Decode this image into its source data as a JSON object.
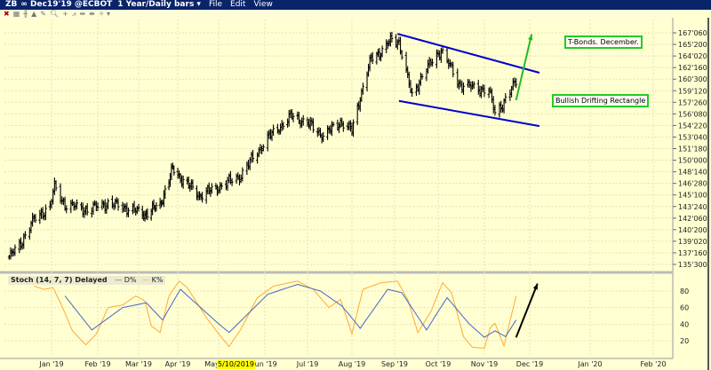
{
  "window": {
    "symbol": "ZB",
    "contract": "∞ Dec19'19 @ECBOT",
    "timeframe": "1 Year/Daily bars",
    "menus": [
      "File",
      "Edit",
      "View"
    ]
  },
  "annotations": {
    "title_note": "T-Bonds. December.",
    "pattern_note": "Bullish Drifting Rectangle"
  },
  "crosshair_date": "5/10/2019",
  "colors": {
    "bars": "#000000",
    "channel": "#0000cc",
    "green_arrow": "#22bb22",
    "k_line": "#ffaa33",
    "d_line": "#4466cc",
    "background": "#ffffd2"
  },
  "chart_data": [
    {
      "type": "ohlc",
      "title": "ZB Dec19'19 @ECBOT 1 Year/Daily bars",
      "y_ticks": [
        "167'060",
        "165'200",
        "164'020",
        "162'160",
        "160'300",
        "159'120",
        "157'260",
        "156'080",
        "154'220",
        "153'040",
        "151'180",
        "150'000",
        "148'140",
        "146'280",
        "145'100",
        "143'240",
        "142'060",
        "140'200",
        "139'020",
        "137'160",
        "135'300"
      ],
      "ylim": [
        135.9375,
        167.1875
      ],
      "x_ticks": [
        "Jan '19",
        "Feb '19",
        "Mar '19",
        "Apr '19",
        "May '19",
        "Jun '19",
        "Jul '19",
        "Aug '19",
        "Sep '19",
        "Oct '19",
        "Nov '19",
        "Dec '19",
        "Jan '20",
        "Feb '20"
      ],
      "close_anchors": [
        [
          "2018-12-03",
          136.9
        ],
        [
          "2018-12-10",
          138.5
        ],
        [
          "2018-12-20",
          142.0
        ],
        [
          "2018-12-31",
          143.8
        ],
        [
          "2019-01-03",
          146.4
        ],
        [
          "2019-01-10",
          144.0
        ],
        [
          "2019-01-25",
          143.3
        ],
        [
          "2019-02-08",
          144.2
        ],
        [
          "2019-02-20",
          143.6
        ],
        [
          "2019-03-06",
          142.7
        ],
        [
          "2019-03-18",
          144.0
        ],
        [
          "2019-03-28",
          148.8
        ],
        [
          "2019-04-05",
          147.3
        ],
        [
          "2019-04-17",
          145.2
        ],
        [
          "2019-05-01",
          146.4
        ],
        [
          "2019-05-15",
          147.8
        ],
        [
          "2019-06-03",
          153.0
        ],
        [
          "2019-06-20",
          156.0
        ],
        [
          "2019-07-01",
          155.0
        ],
        [
          "2019-07-12",
          153.3
        ],
        [
          "2019-07-24",
          155.2
        ],
        [
          "2019-08-01",
          154.0
        ],
        [
          "2019-08-07",
          158.6
        ],
        [
          "2019-08-15",
          163.7
        ],
        [
          "2019-08-23",
          164.8
        ],
        [
          "2019-08-30",
          166.3
        ],
        [
          "2019-09-04",
          166.0
        ],
        [
          "2019-09-13",
          158.6
        ],
        [
          "2019-09-20",
          161.5
        ],
        [
          "2019-10-03",
          164.9
        ],
        [
          "2019-10-15",
          160.3
        ],
        [
          "2019-10-25",
          159.8
        ],
        [
          "2019-11-04",
          159.4
        ],
        [
          "2019-11-08",
          156.3
        ],
        [
          "2019-11-13",
          157.6
        ],
        [
          "2019-11-22",
          160.6
        ]
      ],
      "channel_upper": [
        [
          "2019-09-03",
          167.05
        ],
        [
          "2019-12-06",
          161.8
        ]
      ],
      "channel_lower": [
        [
          "2019-09-04",
          158.0
        ],
        [
          "2019-12-06",
          154.6
        ]
      ],
      "projection_arrow": [
        [
          "2019-11-22",
          158.1
        ],
        [
          "2019-12-02",
          167.0
        ]
      ]
    },
    {
      "type": "line",
      "title": "Stoch (14, 7, 7) Delayed",
      "legend": [
        "D%",
        "K%"
      ],
      "y_ticks": [
        80,
        60,
        40,
        20
      ],
      "ylim": [
        0,
        100
      ],
      "series": [
        {
          "name": "K%",
          "points": [
            [
              "2018-12-20",
              86
            ],
            [
              "2018-12-27",
              82
            ],
            [
              "2019-01-02",
              84
            ],
            [
              "2019-01-08",
              62
            ],
            [
              "2019-01-15",
              32
            ],
            [
              "2019-01-24",
              15
            ],
            [
              "2019-01-31",
              28
            ],
            [
              "2019-02-08",
              60
            ],
            [
              "2019-02-18",
              63
            ],
            [
              "2019-02-27",
              74
            ],
            [
              "2019-03-06",
              68
            ],
            [
              "2019-03-11",
              38
            ],
            [
              "2019-03-18",
              30
            ],
            [
              "2019-03-25",
              74
            ],
            [
              "2019-04-02",
              92
            ],
            [
              "2019-04-08",
              84
            ],
            [
              "2019-04-22",
              48
            ],
            [
              "2019-05-08",
              13
            ],
            [
              "2019-05-16",
              34
            ],
            [
              "2019-05-27",
              72
            ],
            [
              "2019-06-07",
              86
            ],
            [
              "2019-06-24",
              92
            ],
            [
              "2019-07-05",
              82
            ],
            [
              "2019-07-16",
              60
            ],
            [
              "2019-07-24",
              70
            ],
            [
              "2019-08-01",
              28
            ],
            [
              "2019-08-09",
              82
            ],
            [
              "2019-08-22",
              90
            ],
            [
              "2019-09-03",
              92
            ],
            [
              "2019-09-10",
              70
            ],
            [
              "2019-09-17",
              30
            ],
            [
              "2019-09-26",
              55
            ],
            [
              "2019-10-04",
              90
            ],
            [
              "2019-10-10",
              78
            ],
            [
              "2019-10-18",
              25
            ],
            [
              "2019-10-24",
              12
            ],
            [
              "2019-11-01",
              11
            ],
            [
              "2019-11-05",
              36
            ],
            [
              "2019-11-08",
              41
            ],
            [
              "2019-11-14",
              14
            ],
            [
              "2019-11-22",
              74
            ]
          ]
        },
        {
          "name": "D%",
          "points": [
            [
              "2019-01-10",
              74
            ],
            [
              "2019-01-28",
              33
            ],
            [
              "2019-02-18",
              60
            ],
            [
              "2019-03-07",
              66
            ],
            [
              "2019-03-20",
              45
            ],
            [
              "2019-04-03",
              82
            ],
            [
              "2019-05-08",
              30
            ],
            [
              "2019-06-03",
              76
            ],
            [
              "2019-06-24",
              88
            ],
            [
              "2019-07-10",
              80
            ],
            [
              "2019-07-25",
              62
            ],
            [
              "2019-08-07",
              35
            ],
            [
              "2019-08-27",
              82
            ],
            [
              "2019-09-06",
              78
            ],
            [
              "2019-09-23",
              33
            ],
            [
              "2019-10-07",
              72
            ],
            [
              "2019-10-22",
              40
            ],
            [
              "2019-11-01",
              24
            ],
            [
              "2019-11-08",
              32
            ],
            [
              "2019-11-15",
              25
            ],
            [
              "2019-11-22",
              45
            ]
          ]
        }
      ],
      "projection_arrow": [
        [
          "2019-11-22",
          24
        ],
        [
          "2019-12-05",
          89
        ]
      ]
    }
  ]
}
